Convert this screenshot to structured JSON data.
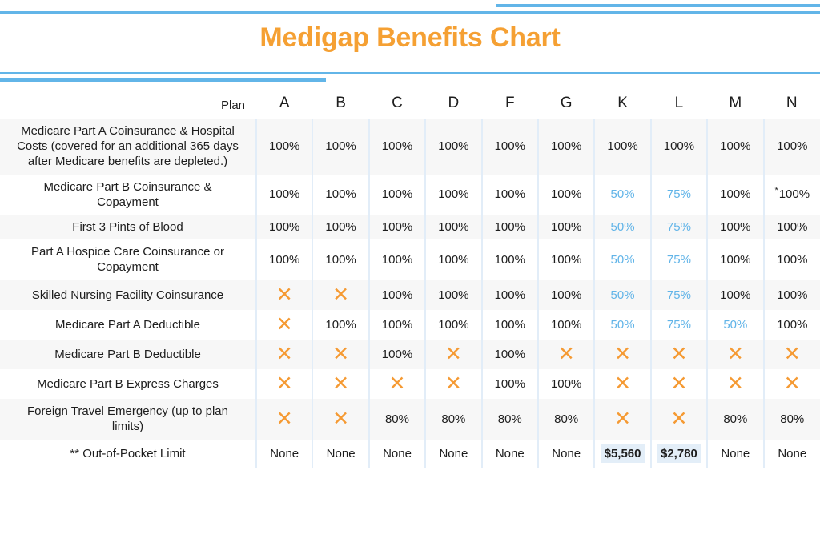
{
  "header": {
    "title": "Medigap Benefits Chart",
    "accent_orange": "#f5a033",
    "accent_blue": "#62b5e8"
  },
  "table": {
    "label_header": "Plan",
    "plans": [
      "A",
      "B",
      "C",
      "D",
      "F",
      "G",
      "K",
      "L",
      "M",
      "N"
    ],
    "rows": [
      {
        "label": "Medicare Part A Coinsurance & Hospital Costs (covered for an additional 365 days after Medicare benefits are depleted.)",
        "values": [
          "100%",
          "100%",
          "100%",
          "100%",
          "100%",
          "100%",
          "100%",
          "100%",
          "100%",
          "100%"
        ]
      },
      {
        "label": "Medicare Part B Coinsurance & Copayment",
        "values": [
          "100%",
          "100%",
          "100%",
          "100%",
          "100%",
          "100%",
          "50%",
          "75%",
          "100%",
          "100%"
        ],
        "blue": [
          6,
          7
        ],
        "star": [
          9
        ]
      },
      {
        "label": "First 3 Pints of Blood",
        "values": [
          "100%",
          "100%",
          "100%",
          "100%",
          "100%",
          "100%",
          "50%",
          "75%",
          "100%",
          "100%"
        ],
        "blue": [
          6,
          7
        ]
      },
      {
        "label": "Part A Hospice Care Coinsurance or Copayment",
        "values": [
          "100%",
          "100%",
          "100%",
          "100%",
          "100%",
          "100%",
          "50%",
          "75%",
          "100%",
          "100%"
        ],
        "blue": [
          6,
          7
        ]
      },
      {
        "label": "Skilled Nursing Facility Coinsurance",
        "values": [
          "✕",
          "✕",
          "100%",
          "100%",
          "100%",
          "100%",
          "50%",
          "75%",
          "100%",
          "100%"
        ],
        "blue": [
          6,
          7
        ]
      },
      {
        "label": "Medicare Part A Deductible",
        "values": [
          "✕",
          "100%",
          "100%",
          "100%",
          "100%",
          "100%",
          "50%",
          "75%",
          "50%",
          "100%"
        ],
        "blue": [
          6,
          7,
          8
        ]
      },
      {
        "label": "Medicare Part B Deductible",
        "values": [
          "✕",
          "✕",
          "100%",
          "✕",
          "100%",
          "✕",
          "✕",
          "✕",
          "✕",
          "✕"
        ]
      },
      {
        "label": "Medicare Part B Express Charges",
        "values": [
          "✕",
          "✕",
          "✕",
          "✕",
          "100%",
          "100%",
          "✕",
          "✕",
          "✕",
          "✕"
        ]
      },
      {
        "label": "Foreign Travel Emergency (up to plan limits)",
        "values": [
          "✕",
          "✕",
          "80%",
          "80%",
          "80%",
          "80%",
          "✕",
          "✕",
          "80%",
          "80%"
        ]
      },
      {
        "label": "** Out-of-Pocket Limit",
        "values": [
          "None",
          "None",
          "None",
          "None",
          "None",
          "None",
          "$5,560",
          "$2,780",
          "None",
          "None"
        ],
        "money": [
          6,
          7
        ]
      }
    ]
  },
  "legend": {
    "x_mark": "✕",
    "x_color": "#f59a33",
    "blue_value_color": "#61b4e8",
    "money_highlight": "#e3eef8"
  }
}
